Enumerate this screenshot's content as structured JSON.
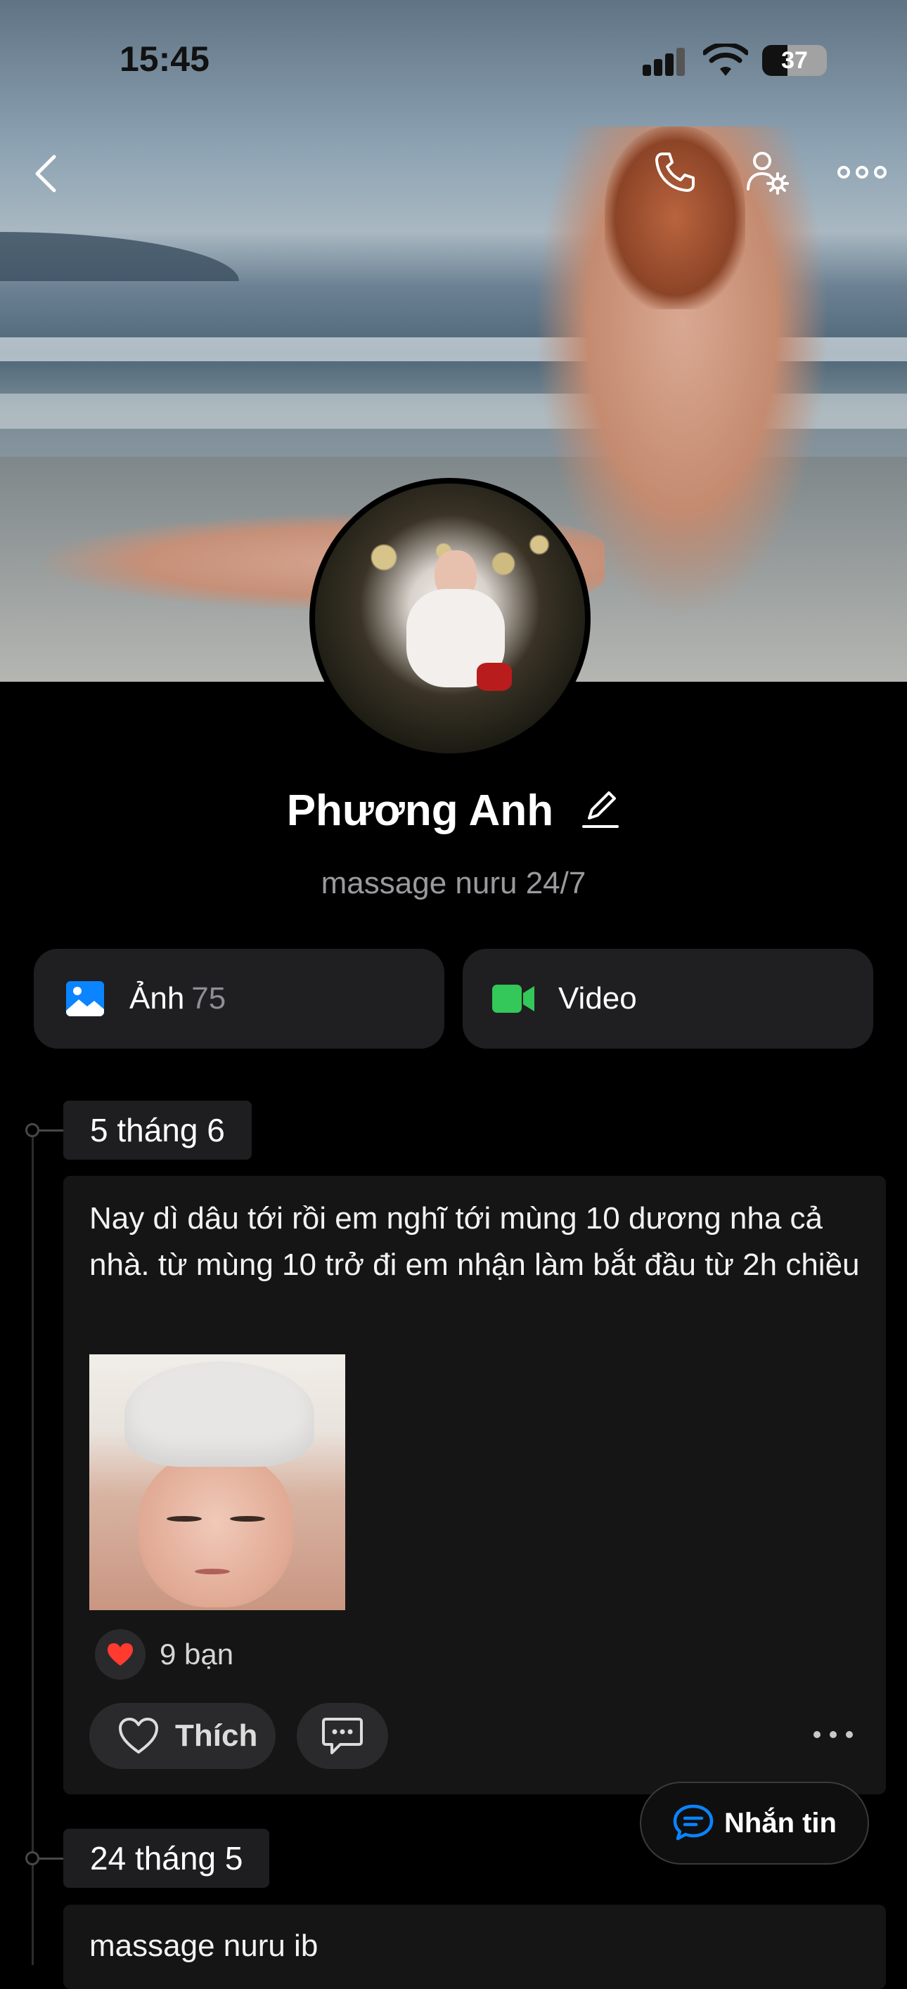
{
  "status_bar": {
    "time": "15:45",
    "battery": "37"
  },
  "profile": {
    "name": "Phương Anh",
    "bio": "massage nuru 24/7"
  },
  "media": {
    "photos_label": "Ảnh",
    "photos_count": "75",
    "video_label": "Video"
  },
  "posts": [
    {
      "date": "5 tháng 6",
      "text": "Nay dì dâu tới rồi em nghĩ tới mùng 10 dương nha cả nhà. từ mùng 10 trở đi em nhận làm bắt đầu từ 2h chiều",
      "reactions": "9 bạn",
      "like_label": "Thích"
    },
    {
      "date": "24 tháng 5",
      "text": "massage nuru ib"
    }
  ],
  "message_button": {
    "label": "Nhắn tin"
  },
  "colors": {
    "accent": "#0a84ff",
    "video_green": "#34c759",
    "heart": "#ff3b30"
  }
}
